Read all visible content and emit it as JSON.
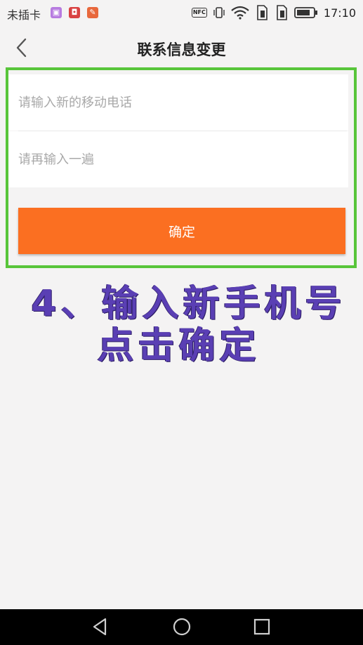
{
  "status_bar": {
    "carrier": "未插卡",
    "time": "17:10",
    "nfc": "NFC",
    "apps": [
      {
        "icon": "photo-app-icon",
        "color": "#b77be0"
      },
      {
        "icon": "red-app-icon",
        "color": "#d94141"
      },
      {
        "icon": "orange-app-icon",
        "color": "#e8683c"
      }
    ]
  },
  "header": {
    "title": "联系信息变更"
  },
  "form": {
    "new_phone_placeholder": "请输入新的移动电话",
    "confirm_phone_placeholder": "请再输入一遍",
    "confirm_button": "确定"
  },
  "annotation": {
    "line1": "4、输入新手机号",
    "line2": "点击确定"
  },
  "colors": {
    "accent": "#fb6f21",
    "highlight": "#58c53a",
    "annotation": "#5a3fb4"
  }
}
